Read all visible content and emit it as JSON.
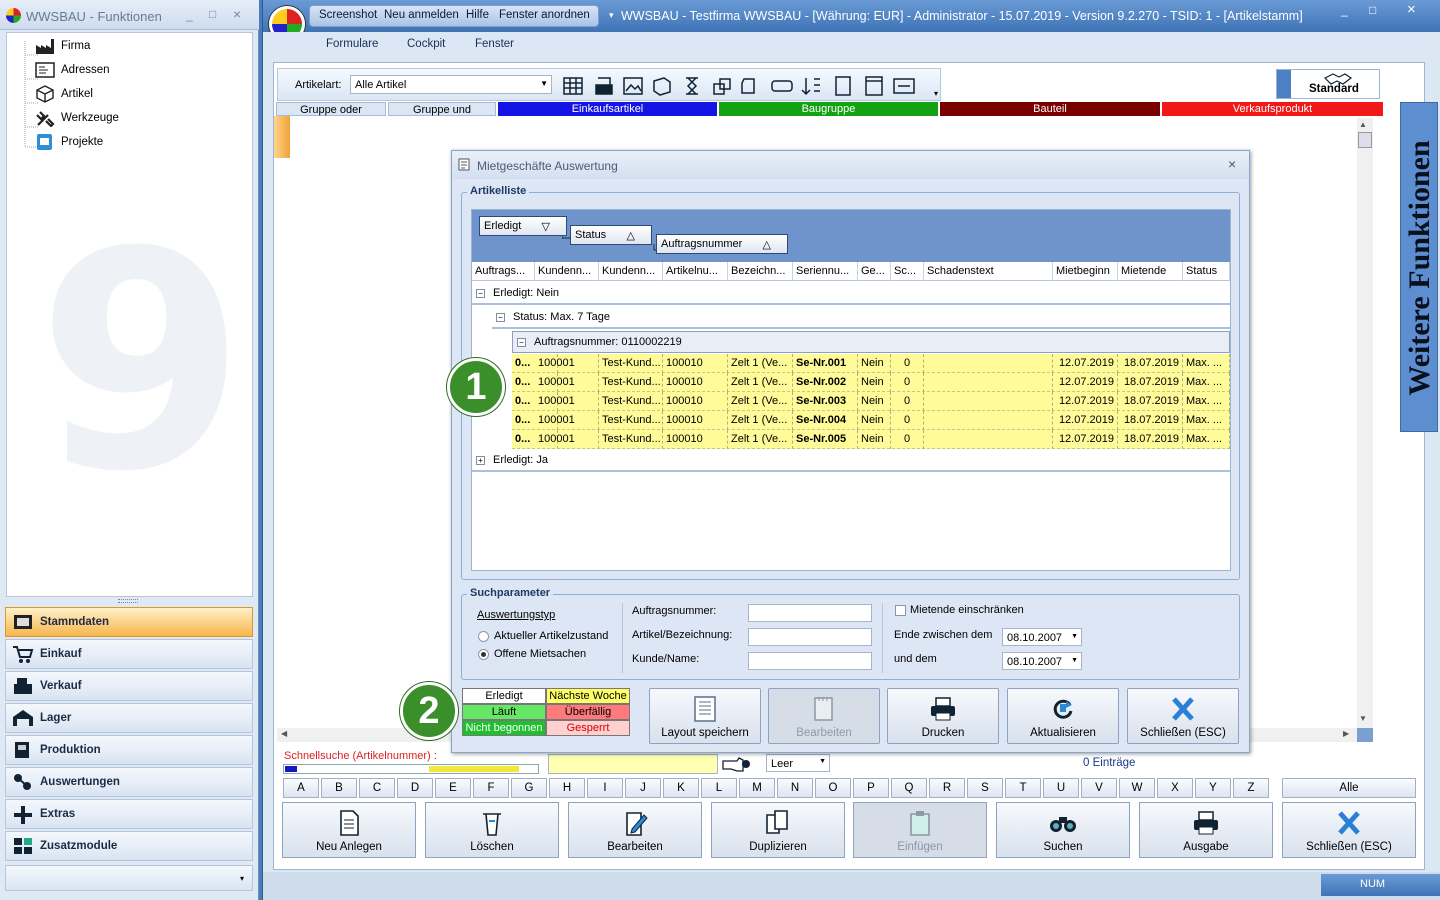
{
  "left_window": {
    "title": "WWSBAU - Funktionen",
    "controls": [
      "_",
      "□",
      "×"
    ],
    "tree": [
      "Firma",
      "Adressen",
      "Artikel",
      "Werkzeuge",
      "Projekte"
    ],
    "nav": [
      "Stammdaten",
      "Einkauf",
      "Verkauf",
      "Lager",
      "Produktion",
      "Auswertungen",
      "Extras",
      "Zusatzmodule"
    ],
    "active_nav": "Stammdaten",
    "watermark": "9"
  },
  "main_window": {
    "quick_access": [
      "Screenshot",
      "Neu anmelden",
      "Hilfe",
      "Fenster anordnen"
    ],
    "title": "WWSBAU - Testfirma WWSBAU - [Währung: EUR] - Administrator - 15.07.2019 - Version 9.2.270 - TSID: 1 - [Artikelstamm]",
    "controls": [
      "_",
      "□",
      "×"
    ],
    "menu": [
      "Formulare",
      "Cockpit",
      "Fenster"
    ],
    "toolbar": {
      "artikelart_label": "Artikelart:",
      "artikelart_value": "Alle Artikel",
      "standard_label": "Standard"
    },
    "categories": [
      {
        "label": "Gruppe oder",
        "bg": "#dbe6f5",
        "color": "#000000"
      },
      {
        "label": "Gruppe und",
        "bg": "#dbe6f5",
        "color": "#000000"
      },
      {
        "label": "Einkaufsartikel",
        "bg": "#1414e6",
        "color": "#ffffff"
      },
      {
        "label": "Baugruppe",
        "bg": "#12a212",
        "color": "#ffffff"
      },
      {
        "label": "Bauteil",
        "bg": "#7a0000",
        "color": "#ffffff"
      },
      {
        "label": "Verkaufsprodukt",
        "bg": "#f01818",
        "color": "#ffffff"
      }
    ],
    "side_panel": "Weitere Funktionen",
    "schnellsuche_label": "Schnellsuche (Artikelnummer) :",
    "filter_value": "Leer",
    "entries": "0 Einträge",
    "letters": [
      "A",
      "B",
      "C",
      "D",
      "E",
      "F",
      "G",
      "H",
      "I",
      "J",
      "K",
      "L",
      "M",
      "N",
      "O",
      "P",
      "Q",
      "R",
      "S",
      "T",
      "U",
      "V",
      "W",
      "X",
      "Y",
      "Z"
    ],
    "alle": "Alle",
    "bottom_buttons": [
      "Neu Anlegen",
      "Löschen",
      "Bearbeiten",
      "Duplizieren",
      "Einfügen",
      "Suchen",
      "Ausgabe",
      "Schließen (ESC)"
    ],
    "disabled_bottom": [
      "Einfügen"
    ],
    "status_num": "NUM"
  },
  "dialog": {
    "title": "Mietgeschäfte Auswertung",
    "artikelliste_label": "Artikelliste",
    "group_chips": [
      {
        "label": "Erledigt",
        "sort": "▽"
      },
      {
        "label": "Status",
        "sort": "△"
      },
      {
        "label": "Auftragsnummer",
        "sort": "△"
      }
    ],
    "columns": [
      "Auftrags...",
      "Kundenn...",
      "Kundenn...",
      "Artikelnu...",
      "Bezeichn...",
      "Seriennu...",
      "Ge...",
      "Sc...",
      "Schadenstext",
      "Mietbeginn",
      "Mietende",
      "Status"
    ],
    "groups": {
      "erledigt_nein": "Erledigt: Nein",
      "status": "Status: Max. 7 Tage",
      "auftrag": "Auftragsnummer: 0110002219",
      "erledigt_ja": "Erledigt: Ja"
    },
    "rows": [
      [
        "0...",
        "100001",
        "Test-Kund...",
        "100010",
        "Zelt 1 (Ve...",
        "Se-Nr.001",
        "Nein",
        "0",
        "",
        "12.07.2019",
        "18.07.2019",
        "Max. ..."
      ],
      [
        "0...",
        "100001",
        "Test-Kund...",
        "100010",
        "Zelt 1 (Ve...",
        "Se-Nr.002",
        "Nein",
        "0",
        "",
        "12.07.2019",
        "18.07.2019",
        "Max. ..."
      ],
      [
        "0...",
        "100001",
        "Test-Kund...",
        "100010",
        "Zelt 1 (Ve...",
        "Se-Nr.003",
        "Nein",
        "0",
        "",
        "12.07.2019",
        "18.07.2019",
        "Max. ..."
      ],
      [
        "0...",
        "100001",
        "Test-Kund...",
        "100010",
        "Zelt 1 (Ve...",
        "Se-Nr.004",
        "Nein",
        "0",
        "",
        "12.07.2019",
        "18.07.2019",
        "Max. ..."
      ],
      [
        "0...",
        "100001",
        "Test-Kund...",
        "100010",
        "Zelt 1 (Ve...",
        "Se-Nr.005",
        "Nein",
        "0",
        "",
        "12.07.2019",
        "18.07.2019",
        "Max. ..."
      ]
    ],
    "suchparameter_label": "Suchparameter",
    "auswertungstyp_label": "Auswertungstyp",
    "radio_options": [
      "Aktueller Artikelzustand",
      "Offene Mietsachen"
    ],
    "radio_selected": 1,
    "fields": [
      "Auftragsnummer:",
      "Artikel/Bezeichnung:",
      "Kunde/Name:"
    ],
    "mietende_checkbox": "Mietende einschränken",
    "ende_zwischen_label": "Ende zwischen dem",
    "und_dem_label": "und dem",
    "date_from": "08.10.2007",
    "date_to": "08.10.2007",
    "legend": [
      {
        "label": "Erledigt",
        "bg": "#ffffff",
        "color": "#000000"
      },
      {
        "label": "Nächste Woche",
        "bg": "#ffff66",
        "color": "#000000"
      },
      {
        "label": "Läuft",
        "bg": "#66e866",
        "color": "#000000"
      },
      {
        "label": "Überfällig",
        "bg": "#ff7a7a",
        "color": "#000000"
      },
      {
        "label": "Nicht begonnen",
        "bg": "#1fbf2f",
        "color": "#ffffff"
      },
      {
        "label": "Gesperrt",
        "bg": "#ffd0d0",
        "color": "#d80000"
      }
    ],
    "buttons": [
      "Layout speichern",
      "Bearbeiten",
      "Drucken",
      "Aktualisieren",
      "Schließen (ESC)"
    ],
    "disabled_buttons": [
      "Bearbeiten"
    ]
  },
  "callouts": [
    "1",
    "2"
  ],
  "colors": {
    "row_highlight": "#fffb99",
    "callout": "#3b8f2b",
    "active_nav": "#f7b54c"
  }
}
